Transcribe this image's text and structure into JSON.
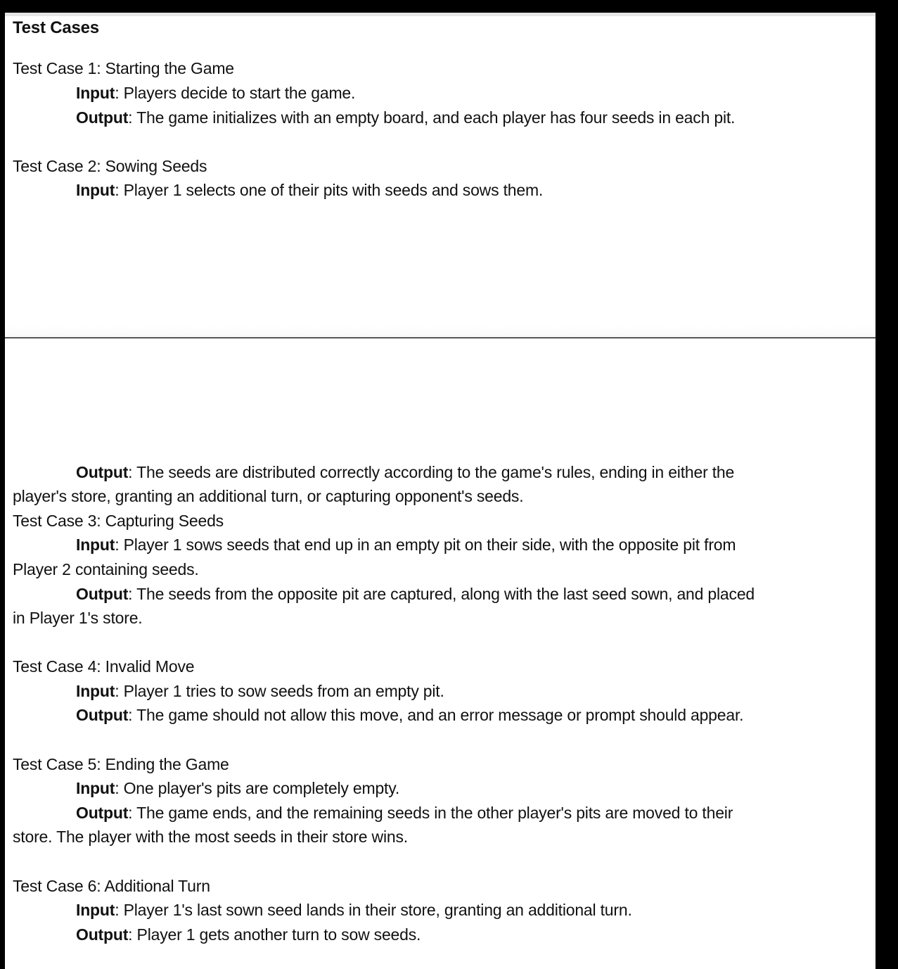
{
  "document": {
    "heading": "Test Cases",
    "test_cases": [
      {
        "title": "Test Case 1: Starting the Game",
        "input_label": "Input",
        "input_text": ": Players decide to start the game.",
        "output_label": "Output",
        "output_text": ": The game initializes with an empty board, and each player has four seeds in each pit."
      },
      {
        "title": "Test Case 2: Sowing Seeds",
        "input_label": "Input",
        "input_text": ": Player 1 selects one of their pits with seeds and sows them.",
        "output_label": "Output",
        "output_text_line1": ": The seeds are distributed correctly according to the game's rules, ending in either the",
        "output_text_line2": "player's store, granting an additional turn, or capturing opponent's seeds."
      },
      {
        "title": "Test Case 3: Capturing Seeds",
        "input_label": "Input",
        "input_text_line1": ": Player 1 sows seeds that end up in an empty pit on their side, with the opposite pit from",
        "input_text_line2": "Player 2 containing seeds.",
        "output_label": "Output",
        "output_text_line1": ": The seeds from the opposite pit are captured, along with the last seed sown, and placed",
        "output_text_line2": "in Player 1's store."
      },
      {
        "title": "Test Case 4: Invalid Move",
        "input_label": "Input",
        "input_text": ": Player 1 tries to sow seeds from an empty pit.",
        "output_label": "Output",
        "output_text": ": The game should not allow this move, and an error message or prompt should appear."
      },
      {
        "title": "Test Case 5: Ending the Game",
        "input_label": "Input",
        "input_text": ": One player's pits are completely empty.",
        "output_label": "Output",
        "output_text_line1": ": The game ends, and the remaining seeds in the other player's pits are moved to their",
        "output_text_line2": "store. The player with the most seeds in their store wins."
      },
      {
        "title": "Test Case 6: Additional Turn",
        "input_label": "Input",
        "input_text": ": Player 1's last sown seed lands in their store, granting an additional turn.",
        "output_label": "Output",
        "output_text": ": Player 1 gets another turn to sow seeds."
      }
    ]
  }
}
